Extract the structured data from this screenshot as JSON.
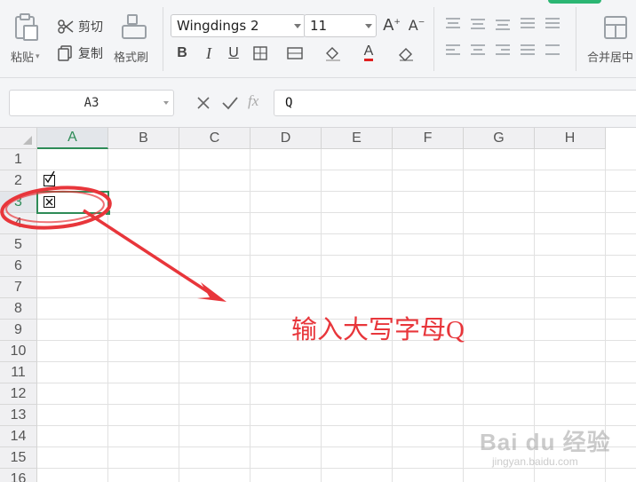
{
  "ribbon": {
    "paste_label": "粘贴",
    "cut_label": "剪切",
    "copy_label": "复制",
    "format_painter_label": "格式刷",
    "font_name": "Wingdings 2",
    "font_size": "11",
    "merge_label": "合并居中"
  },
  "formula_bar": {
    "name_box": "A3",
    "fx_label": "fx",
    "content": "Q"
  },
  "sheet": {
    "columns": [
      "A",
      "B",
      "C",
      "D",
      "E",
      "F",
      "G",
      "H"
    ],
    "rows": [
      "1",
      "2",
      "3",
      "4",
      "5",
      "6",
      "7",
      "8",
      "9",
      "10",
      "11",
      "12",
      "13",
      "14",
      "15",
      "16"
    ],
    "active_cell": "A3",
    "cells": {
      "A2": "checkbox-checked",
      "A3": "checkbox-crossed"
    }
  },
  "annotation": {
    "text": "输入大写字母Q",
    "color": "#e8363b"
  },
  "watermark": {
    "main": "Bai du 经验",
    "sub": "jingyan.baidu.com"
  },
  "colors": {
    "accent_green": "#2e8b57",
    "annotation_red": "#e8363b"
  }
}
